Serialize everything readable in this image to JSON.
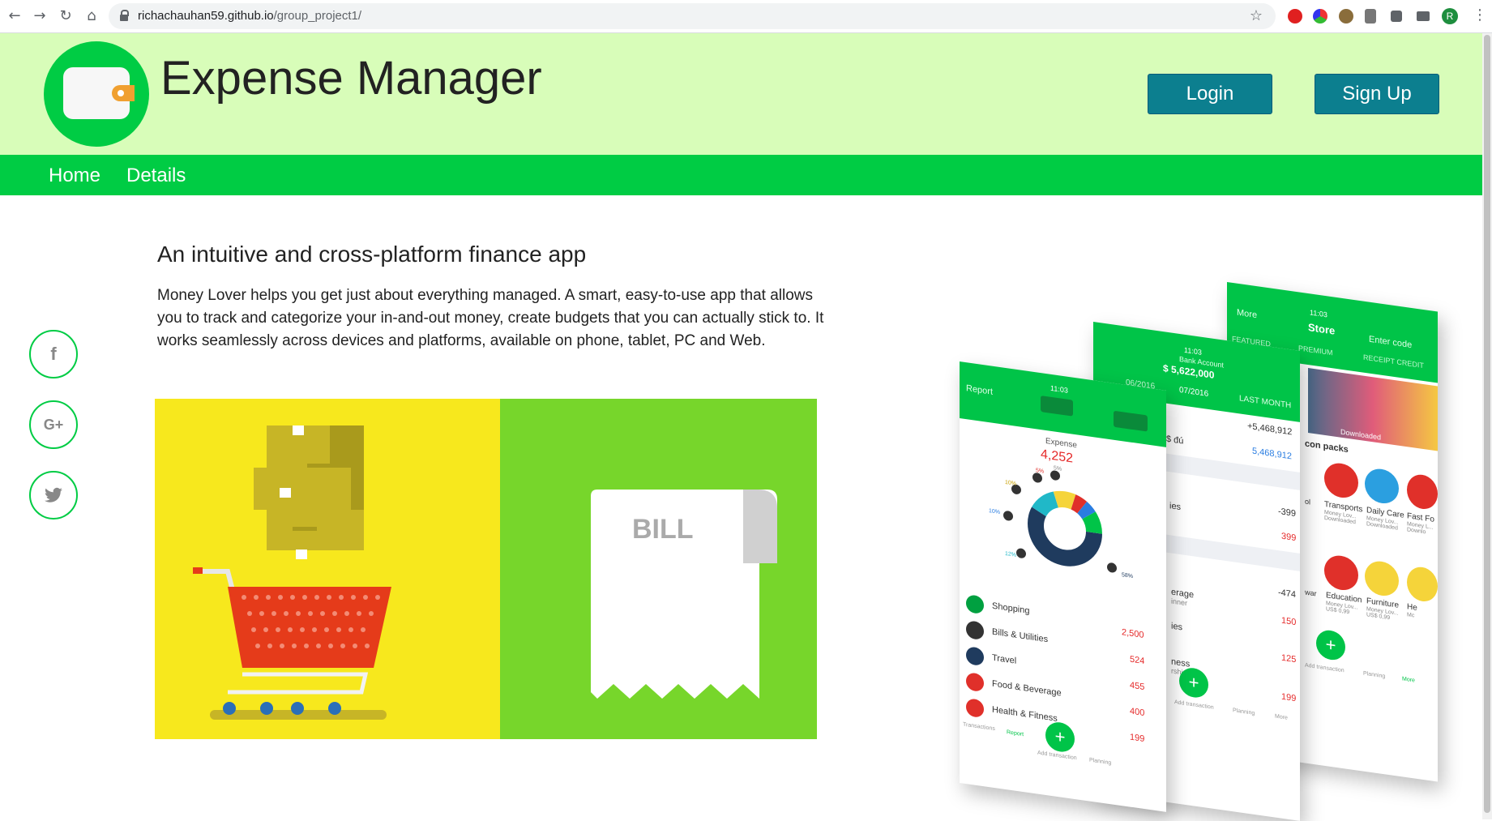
{
  "browser": {
    "back_icon": "←",
    "forward_icon": "→",
    "reload_icon": "↻",
    "home_icon": "⌂",
    "url_host": "richachauhan59.github.io",
    "url_path": "/group_project1/",
    "star_icon": "☆",
    "avatar_letter": "R",
    "menu_icon": "⋮"
  },
  "header": {
    "title": "Expense Manager",
    "login_label": "Login",
    "signup_label": "Sign Up"
  },
  "nav": {
    "items": [
      {
        "label": "Home"
      },
      {
        "label": "Details"
      }
    ]
  },
  "social": {
    "facebook": "f",
    "google": "G+",
    "twitter": "t"
  },
  "main": {
    "subtitle": "An intuitive and cross-platform finance app",
    "description": "Money Lover helps you get just about everything managed. A smart, easy-to-use app that allows you to track and categorize your in-and-out money, create budgets that you can actually stick to. It works seamlessly across devices and platforms, available on phone, tablet, PC and Web.",
    "bill_label": "BILL"
  },
  "phones": {
    "report": {
      "back_label": "Report",
      "time": "11:03",
      "expense_label": "Expense",
      "expense_value": "4,252",
      "pct_labels": [
        "5%",
        "5%",
        "10%",
        "10%",
        "12%",
        "58%"
      ],
      "rows": [
        {
          "name": "Shopping",
          "value": ""
        },
        {
          "name": "Bills & Utilities",
          "value": "2,500"
        },
        {
          "name": "Travel",
          "value": "524"
        },
        {
          "name": "Food & Beverage",
          "value": "455"
        },
        {
          "name": "Health & Fitness",
          "value": "400"
        },
        {
          "name": "",
          "value": "199"
        }
      ],
      "tabs": [
        "Transactions",
        "Report",
        "Add transaction",
        "Planning"
      ]
    },
    "bank": {
      "time": "11:03",
      "account_label": "Bank Account",
      "balance": "$ 5,622,000",
      "prev_month": "06/2016",
      "month": "07/2016",
      "last_month": "LAST MONTH",
      "values": [
        "+5,468,912",
        "5,468,912",
        "-399",
        "399",
        "-474",
        "150",
        "125",
        "199"
      ],
      "fragments": [
        "$ đú",
        "ies",
        "erage",
        "inner",
        "ies",
        "ness",
        "rship"
      ],
      "tabs": [
        "Add transaction",
        "Planning",
        "More"
      ]
    },
    "store": {
      "time": "11:03",
      "back_label": "More",
      "title": "Store",
      "enter_code": "Enter code",
      "tabs": [
        "FEATURED",
        "PREMIUM",
        "RECEIPT CREDIT"
      ],
      "downloaded": "Downloaded",
      "section": "con packs",
      "items_row1": [
        {
          "name": "ol",
          "sub": ""
        },
        {
          "name": "Transports",
          "sub": "Money Lov... Downloaded"
        },
        {
          "name": "Daily Care",
          "sub": "Money Lov... Downloaded"
        },
        {
          "name": "Fast Fo",
          "sub": "Money L... Downlo"
        }
      ],
      "items_row2": [
        {
          "name": "war",
          "sub": ""
        },
        {
          "name": "Education",
          "sub": "Money Lov... US$ 0,99"
        },
        {
          "name": "Furniture",
          "sub": "Money Lov... US$ 0,99"
        },
        {
          "name": "He",
          "sub": "Mc"
        }
      ],
      "bottom_tabs": [
        "Add transaction",
        "Planning",
        "More"
      ]
    }
  },
  "colors": {
    "header_bg": "#d8fdb9",
    "brand_green": "#00cc44",
    "button_teal": "#0c7f8f",
    "illus_yellow": "#f7e81d",
    "illus_green": "#77d62b"
  }
}
